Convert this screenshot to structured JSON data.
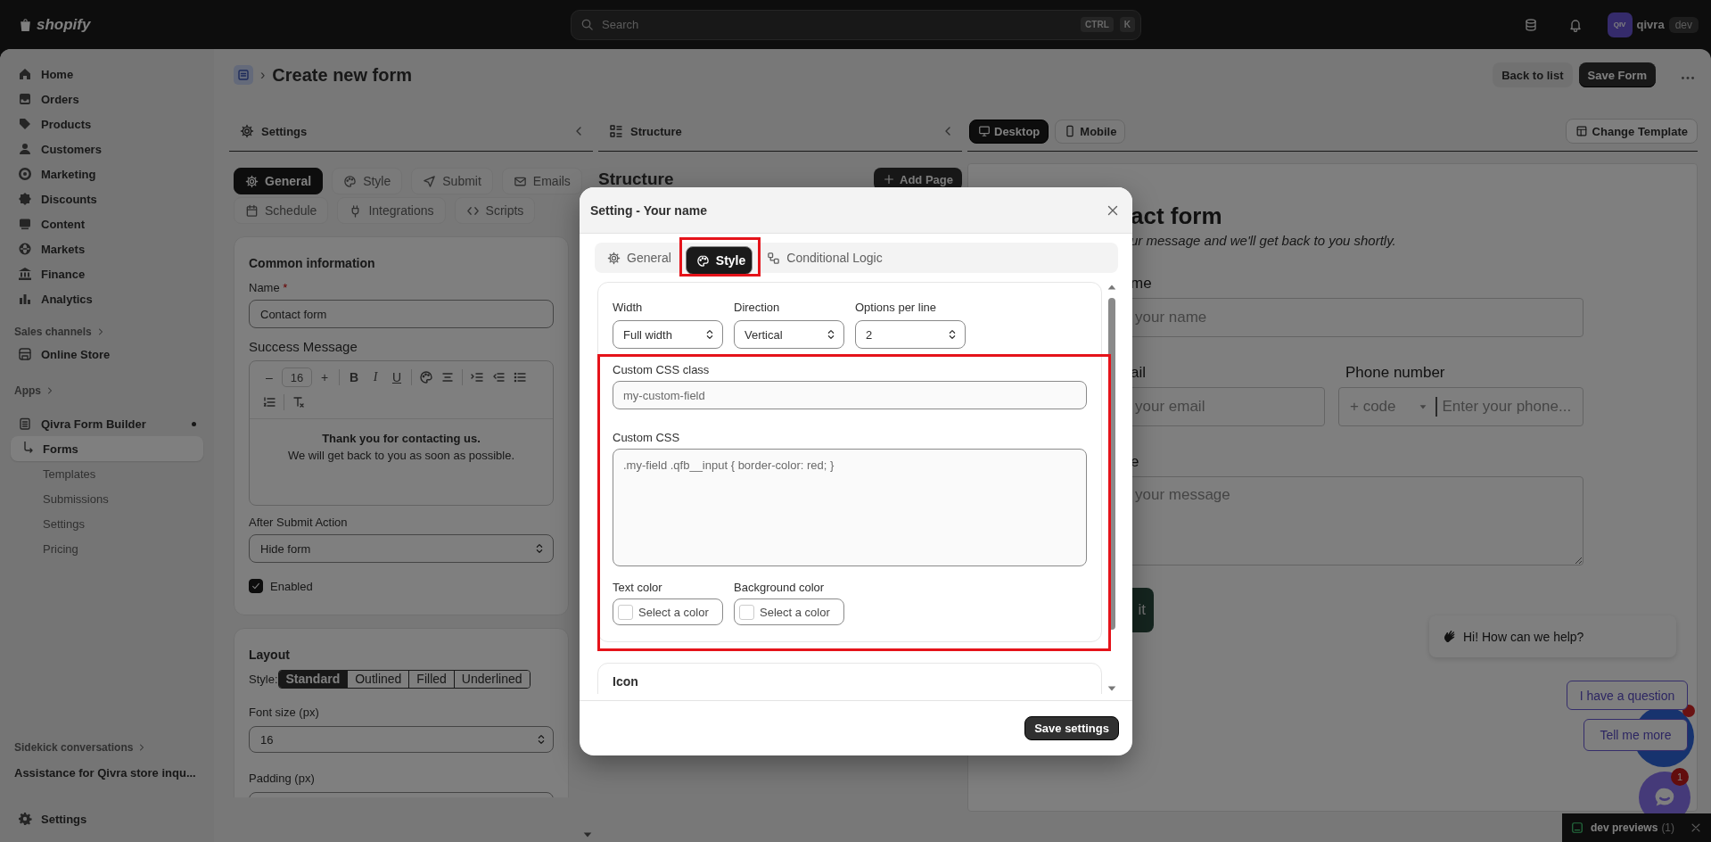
{
  "topbar": {
    "logo": "shopify",
    "search": {
      "placeholder": "Search",
      "keys": [
        "CTRL",
        "K"
      ]
    },
    "account": {
      "initials": "QIV",
      "name": "qivra",
      "badge": "dev"
    }
  },
  "sidebar": {
    "items": [
      {
        "label": "Home",
        "selected": false
      },
      {
        "label": "Orders",
        "selected": false
      },
      {
        "label": "Products",
        "selected": false
      },
      {
        "label": "Customers",
        "selected": false
      },
      {
        "label": "Marketing",
        "selected": false
      },
      {
        "label": "Discounts",
        "selected": false
      },
      {
        "label": "Content",
        "selected": false
      },
      {
        "label": "Markets",
        "selected": false
      },
      {
        "label": "Finance",
        "selected": false
      },
      {
        "label": "Analytics",
        "selected": false
      }
    ],
    "sales_channels": {
      "heading": "Sales channels",
      "items": [
        {
          "label": "Online Store",
          "selected": false
        }
      ]
    },
    "apps": {
      "heading": "Apps",
      "items": [
        {
          "label": "Qivra Form Builder",
          "selected": false,
          "children": [
            {
              "label": "Forms",
              "selected": true
            },
            {
              "label": "Templates",
              "selected": false
            },
            {
              "label": "Submissions",
              "selected": false
            },
            {
              "label": "Settings",
              "selected": false
            },
            {
              "label": "Pricing",
              "selected": false
            }
          ]
        }
      ]
    },
    "sidekick": {
      "heading": "Sidekick conversations",
      "items": [
        {
          "label": "Assistance for Qivra store inqu...",
          "selected": false
        }
      ]
    },
    "settings": {
      "label": "Settings",
      "selected": false
    }
  },
  "page_header": {
    "separator": "›",
    "title": "Create new form",
    "actions": [
      {
        "label": "Back to list",
        "kind": "secondary"
      },
      {
        "label": "Save Form",
        "kind": "primary"
      }
    ]
  },
  "settings_panel": {
    "title": "Settings",
    "tabs": [
      {
        "label": "General",
        "selected": true
      },
      {
        "label": "Style",
        "selected": false
      },
      {
        "label": "Submit",
        "selected": false
      },
      {
        "label": "Emails",
        "selected": false
      },
      {
        "label": "Schedule",
        "selected": false
      },
      {
        "label": "Integrations",
        "selected": false
      },
      {
        "label": "Scripts",
        "selected": false
      }
    ],
    "common": {
      "heading": "Common information",
      "name_label": "Name",
      "required_mark": "*",
      "name_value": "Contact form",
      "success_label": "Success Message",
      "toolbar": {
        "minus": "–",
        "font_size": "16",
        "plus": "+",
        "format_buttons": [
          "B",
          "I",
          "U"
        ]
      },
      "message": [
        "Thank you for contacting us.",
        "We will get back to you as soon as possible."
      ],
      "after_submit_label": "After Submit Action",
      "after_submit_value": "Hide form",
      "enabled": {
        "label": "Enabled",
        "checked": true
      }
    },
    "layout": {
      "heading": "Layout",
      "style_label": "Style:",
      "styles": [
        {
          "label": "Standard",
          "selected": true
        },
        {
          "label": "Outlined",
          "selected": false
        },
        {
          "label": "Filled",
          "selected": false
        },
        {
          "label": "Underlined",
          "selected": false
        }
      ],
      "font_size_label": "Font size (px)",
      "font_size_value": "16",
      "padding_label": "Padding (px)"
    }
  },
  "structure_panel": {
    "title": "Structure",
    "heading": "Structure",
    "add_page": "Add Page"
  },
  "preview": {
    "devices": [
      {
        "label": "Desktop",
        "selected": true
      },
      {
        "label": "Mobile",
        "selected": false
      }
    ],
    "change_template": "Change Template",
    "form": {
      "title": "act form",
      "subtitle": "ur message and we'll get back to you shortly.",
      "rows": [
        [
          {
            "kind": "text",
            "label": "me",
            "placeholder": "your name"
          }
        ],
        [
          {
            "kind": "text",
            "label": "ail",
            "placeholder": "your email"
          },
          {
            "kind": "phone",
            "label": "Phone number",
            "code": "+ code",
            "placeholder": "Enter your phone..."
          }
        ],
        [
          {
            "kind": "textarea",
            "label": "e",
            "placeholder": "your message"
          }
        ]
      ],
      "submit": "it"
    }
  },
  "modal": {
    "title": "Setting - Your name",
    "tabs": [
      {
        "label": "General",
        "selected": false
      },
      {
        "label": "Style",
        "selected": true
      },
      {
        "label": "Conditional Logic",
        "selected": false
      }
    ],
    "selects": [
      {
        "label": "Width",
        "value": "Full width"
      },
      {
        "label": "Direction",
        "value": "Vertical"
      },
      {
        "label": "Options per line",
        "value": "2"
      }
    ],
    "css_class": {
      "label": "Custom CSS class",
      "placeholder": "my-custom-field"
    },
    "custom_css": {
      "label": "Custom CSS",
      "placeholder": ".my-field .qfb__input { border-color: red; }"
    },
    "colors": [
      {
        "label": "Text color",
        "placeholder": "Select a color"
      },
      {
        "label": "Background color",
        "placeholder": "Select a color"
      }
    ],
    "next_section": "Icon",
    "save": "Save settings"
  },
  "chat": {
    "greeting": "Hi! How can we help?",
    "quick_replies": [
      "I have a question",
      "Tell me more"
    ],
    "badge": "1"
  },
  "dev_bar": {
    "label": "dev previews",
    "count": "(1)"
  }
}
